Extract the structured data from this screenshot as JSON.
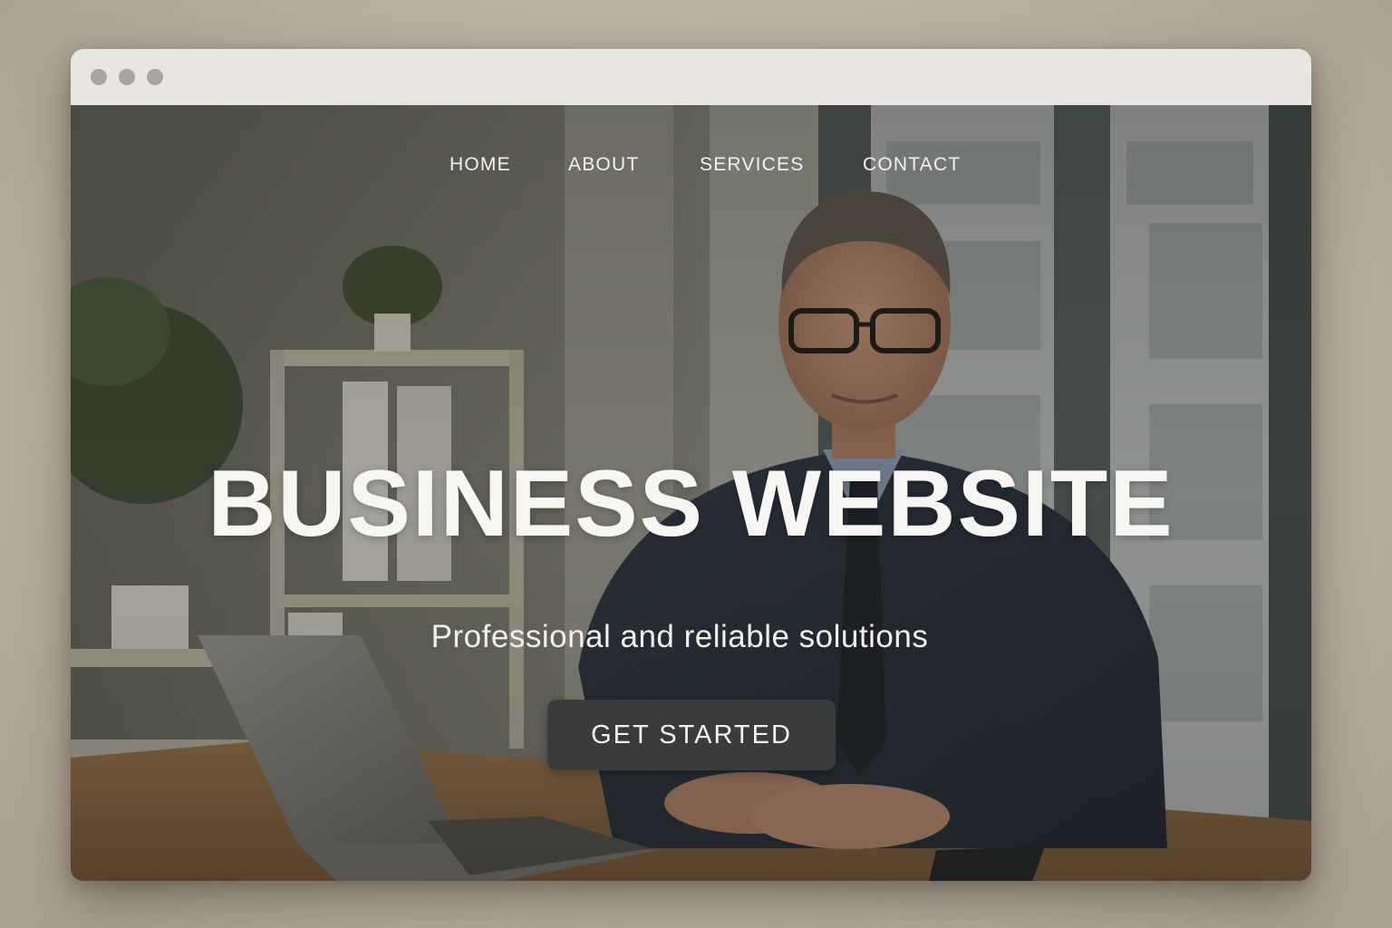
{
  "window": {
    "controls": [
      "window-dot",
      "window-dot",
      "window-dot"
    ]
  },
  "nav": {
    "items": [
      {
        "label": "HOME"
      },
      {
        "label": "ABOUT"
      },
      {
        "label": "SERVICES"
      },
      {
        "label": "CONTACT"
      }
    ]
  },
  "hero": {
    "title": "BUSINESS WEBSITE",
    "subtitle": "Professional and reliable solutions",
    "cta_label": "GET STARTED",
    "image_icon": "businessman-at-desk-photo"
  },
  "colors": {
    "cta_background": "#3a3b3b",
    "text": "#f7f6f3",
    "titlebar": "#e9e6e1"
  }
}
